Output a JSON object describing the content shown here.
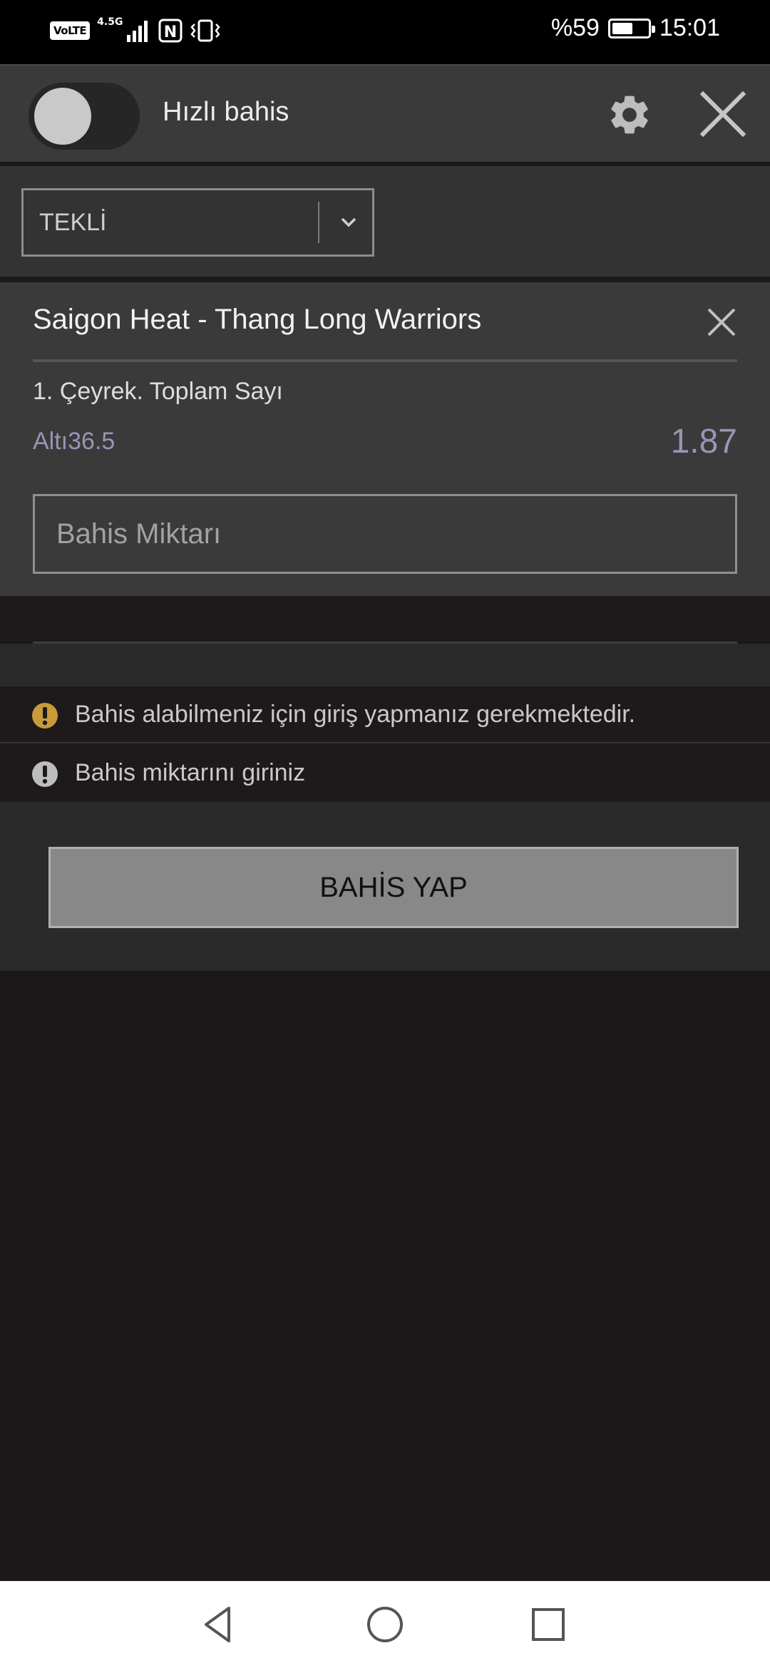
{
  "status_bar": {
    "volte": "VoLTE",
    "network": "4.5G",
    "nfc": "N",
    "battery_percent_text": "%59",
    "battery_level": 0.59,
    "time": "15:01"
  },
  "header": {
    "quick_bet_label": "Hızlı bahis",
    "quick_bet_enabled": false,
    "icons": {
      "settings": "gear-icon",
      "close": "close-icon"
    }
  },
  "bet_type": {
    "selected": "TEKLİ",
    "icon": "chevron-down-icon"
  },
  "bet": {
    "match": "Saigon Heat - Thang Long Warriors",
    "market": "1. Çeyrek. Toplam Sayı",
    "selection": "Altı36.5",
    "odds": "1.87",
    "stake_placeholder": "Bahis Miktarı",
    "stake_value": ""
  },
  "messages": [
    {
      "text": "Bahis alabilmeniz için giriş yapmanız gerekmektedir.",
      "icon": "warning-icon",
      "color": "#c99a3a"
    },
    {
      "text": "Bahis miktarını giriniz",
      "icon": "info-exclamation-icon",
      "color": "#bdbdbd"
    }
  ],
  "actions": {
    "place_bet_label": "BAHİS YAP"
  },
  "colors": {
    "accent_odds": "#9a94b6",
    "background": "#1c1718",
    "panel": "#3a3a3a"
  }
}
